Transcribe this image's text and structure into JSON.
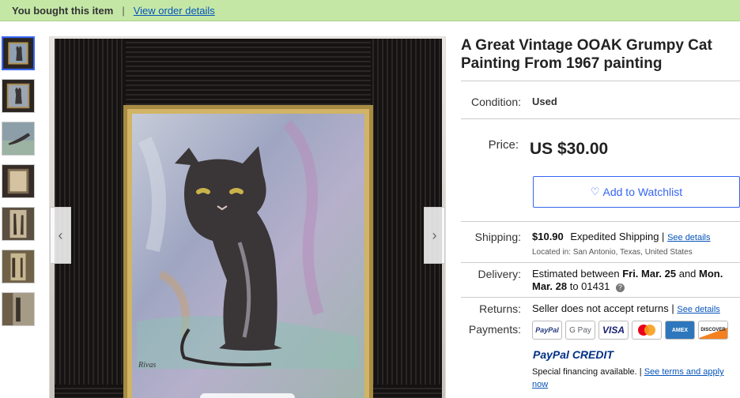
{
  "banner": {
    "bought_text": "You bought this item",
    "separator": "|",
    "order_link": "View order details"
  },
  "viewer": {
    "prev_arrow": "‹",
    "next_arrow": "›"
  },
  "item": {
    "title": "A Great Vintage OOAK Grumpy Cat Painting From 1967 painting",
    "condition_label": "Condition:",
    "condition_value": "Used",
    "price_label": "Price:",
    "price_value": "US $30.00",
    "watch_icon": "♡",
    "watch_label": "Add to Watchlist"
  },
  "shipping": {
    "label": "Shipping:",
    "cost": "$10.90",
    "method": "Expedited Shipping",
    "sep": "|",
    "details_link": "See details",
    "location": "Located in: San Antonio, Texas, United States"
  },
  "delivery": {
    "label": "Delivery:",
    "line1_prefix": "Estimated between ",
    "line1_bold": "Fri. Mar. 25",
    "line1_mid": " and ",
    "line1_bold2": "Mon.",
    "line2_bold": "Mar. 28",
    "line2_suffix": " to 01431",
    "help_icon": "?"
  },
  "returns": {
    "label": "Returns:",
    "text": "Seller does not accept returns",
    "sep": "|",
    "details_link": "See details"
  },
  "payments": {
    "label": "Payments:",
    "methods": [
      "PayPal",
      "G Pay",
      "VISA",
      "Mastercard",
      "AMEX",
      "DISCOVER"
    ],
    "paypal_credit": "PayPal CREDIT",
    "financing_text": "Special financing available.",
    "sep": "|",
    "terms_link_1": "See terms and apply",
    "terms_link_2": "now"
  },
  "colors": {
    "banner_bg": "#c4e7a6",
    "link": "#0654ba",
    "accent": "#3665f3"
  }
}
